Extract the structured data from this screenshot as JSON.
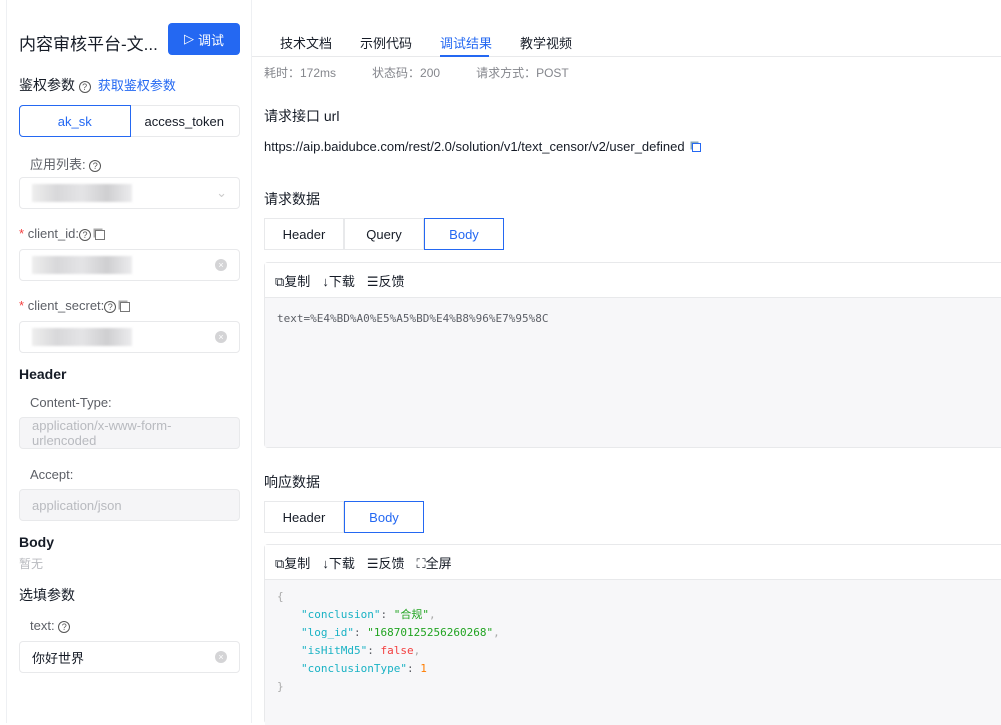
{
  "left": {
    "title": "内容审核平台-文...",
    "run_button": "调试",
    "auth_heading": "鉴权参数",
    "get_auth_link": "获取鉴权参数",
    "auth_tabs": [
      "ak_sk",
      "access_token"
    ],
    "app_list_label": "应用列表:",
    "client_id_label": "client_id:",
    "client_secret_label": "client_secret:",
    "header_heading": "Header",
    "content_type_label": "Content-Type:",
    "content_type_value": "application/x-www-form-urlencoded",
    "accept_label": "Accept:",
    "accept_value": "application/json",
    "body_heading": "Body",
    "body_empty": "暂无",
    "optional_heading": "选填参数",
    "text_label": "text:",
    "text_value": "你好世界"
  },
  "tabs": [
    "技术文档",
    "示例代码",
    "调试结果",
    "教学视频"
  ],
  "meta": [
    "耗时：172ms",
    "状态码：200",
    "请求方式：POST"
  ],
  "url_heading": "请求接口 url",
  "url": "https://aip.baidubce.com/rest/2.0/solution/v1/text_censor/v2/user_defined",
  "request": {
    "heading": "请求数据",
    "tabs": [
      "Header",
      "Query",
      "Body"
    ],
    "toolbar": [
      "复制",
      "下载",
      "反馈"
    ],
    "body": "text=%E4%BD%A0%E5%A5%BD%E4%B8%96%E7%95%8C"
  },
  "response": {
    "heading": "响应数据",
    "tabs": [
      "Header",
      "Body"
    ],
    "toolbar": [
      "复制",
      "下载",
      "反馈",
      "全屏"
    ],
    "json": {
      "k1": "\"conclusion\"",
      "v1": "\"合规\"",
      "k2": "\"log_id\"",
      "v2": "\"16870125256260268\"",
      "k3": "\"isHitMd5\"",
      "v3": "false",
      "k4": "\"conclusionType\"",
      "v4": "1"
    }
  }
}
